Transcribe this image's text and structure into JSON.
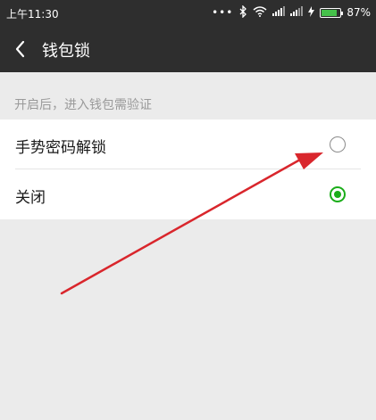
{
  "status_bar": {
    "time": "上午11:30",
    "dots": "•••",
    "icons": [
      "bluetooth-icon",
      "wifi-icon",
      "signal-icon",
      "signal-icon",
      "charging-icon",
      "battery-icon"
    ],
    "battery_level": 0.87,
    "battery_percent": "87%"
  },
  "header": {
    "back_icon": "chevron-left-icon",
    "title": "钱包锁"
  },
  "section": {
    "caption": "开启后，进入钱包需验证"
  },
  "options": [
    {
      "label": "手势密码解锁",
      "selected": false
    },
    {
      "label": "关闭",
      "selected": true
    }
  ],
  "colors": {
    "bar_background": "#2e2e2e",
    "accent_green": "#1aad19",
    "page_background": "#ebebeb",
    "annotation_arrow": "#d9262c"
  }
}
